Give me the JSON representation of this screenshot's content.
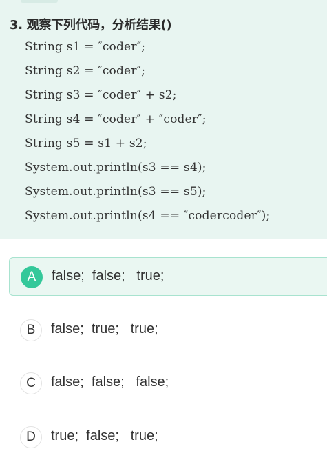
{
  "question": {
    "title": "3. 观察下列代码，分析结果()",
    "code_lines": [
      "String s1 = ″coder″;",
      "String s2 = ″coder″;",
      "String s3 = ″coder″ + s2;",
      "String s4 = ″coder″ + ″coder″;",
      "String s5 = s1 + s2;",
      "System.out.println(s3 == s4);",
      "System.out.println(s3 == s5);",
      "System.out.println(s4 == ″codercoder″);"
    ]
  },
  "options": [
    {
      "letter": "A",
      "text": "false;  false;   true;",
      "selected": true
    },
    {
      "letter": "B",
      "text": "false;  true;   true;",
      "selected": false
    },
    {
      "letter": "C",
      "text": "false;  false;   false;",
      "selected": false
    },
    {
      "letter": "D",
      "text": "true;  false;   true;",
      "selected": false
    }
  ],
  "colors": {
    "card_background": "#e8f5f1",
    "selected_badge": "#34c89a",
    "selected_border": "#a8e3cf",
    "selected_background": "#eaf7f2"
  }
}
